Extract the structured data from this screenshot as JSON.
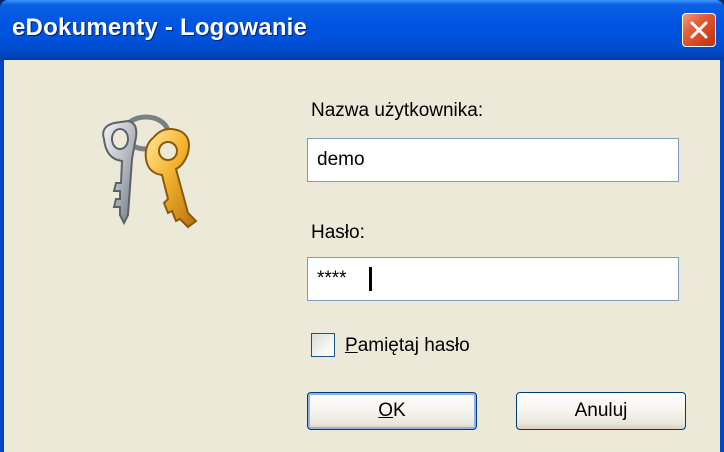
{
  "window": {
    "title": "eDokumenty - Logowanie",
    "close_icon": "close-icon"
  },
  "form": {
    "username_label": "Nazwa użytkownika:",
    "username_value": "demo",
    "password_label": "Hasło:",
    "password_value": "****",
    "remember_label": "Pamiętaj hasło",
    "remember_checked": false
  },
  "buttons": {
    "ok_label": "OK",
    "cancel_label": "Anuluj"
  },
  "icons": {
    "keys": "keys-icon"
  },
  "colors": {
    "titlebar": "#0054e3",
    "close_button": "#d2431c",
    "background": "#ece9d8"
  }
}
